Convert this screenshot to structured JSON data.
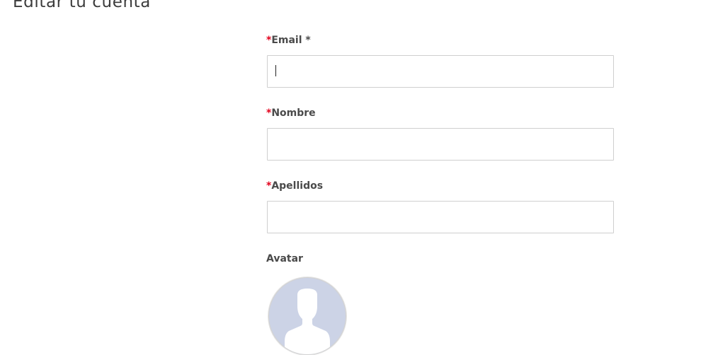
{
  "page": {
    "title": "Editar tu cuenta"
  },
  "form": {
    "required_mark": "*",
    "email": {
      "label": "Email",
      "label_suffix": " *",
      "value": "",
      "placeholder": "",
      "focused": true
    },
    "nombre": {
      "label": "Nombre",
      "value": "",
      "placeholder": ""
    },
    "apellidos": {
      "label": "Apellidos",
      "value": "",
      "placeholder": ""
    },
    "avatar": {
      "label": "Avatar",
      "icon": "default-user-avatar-icon"
    }
  },
  "colors": {
    "required": "#e3001b",
    "label": "#4a4a4a",
    "input_border": "#cfcfcf",
    "avatar_background": "#ccd3e6",
    "avatar_silhouette": "#ffffff"
  }
}
